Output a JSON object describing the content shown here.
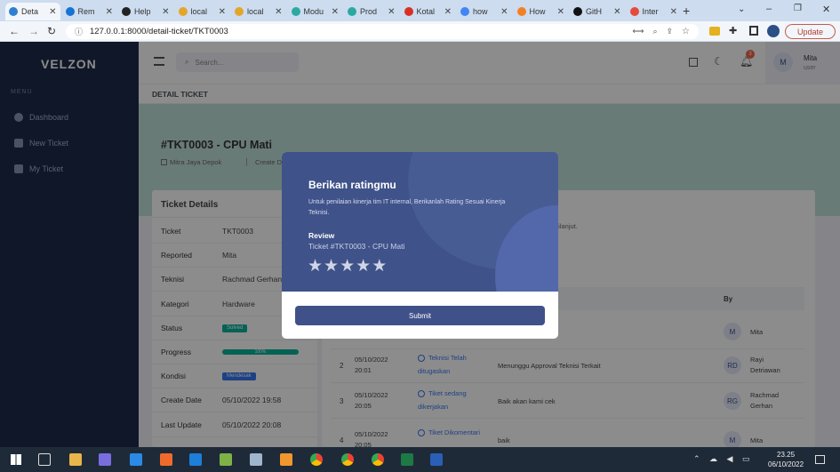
{
  "browser": {
    "tabs": [
      {
        "label": "Deta",
        "color": "#2f7fd1",
        "active": true
      },
      {
        "label": "Rem",
        "color": "#1573d4",
        "active": false
      },
      {
        "label": "Help",
        "color": "#222222",
        "active": false
      },
      {
        "label": "local",
        "color": "#e3a62a",
        "active": false
      },
      {
        "label": "local",
        "color": "#e3a62a",
        "active": false
      },
      {
        "label": "Modu",
        "color": "#2ba9a0",
        "active": false
      },
      {
        "label": "Prod",
        "color": "#2ba9a0",
        "active": false
      },
      {
        "label": "Kotal",
        "color": "#d93025",
        "active": false
      },
      {
        "label": "how",
        "color": "#4285f4",
        "active": false
      },
      {
        "label": "How",
        "color": "#f48024",
        "active": false
      },
      {
        "label": "GitH",
        "color": "#111111",
        "active": false
      },
      {
        "label": "Inter",
        "color": "#e64a3b",
        "active": false
      }
    ],
    "url": "127.0.0.1:8000/detail-ticket/TKT0003",
    "update_label": "Update"
  },
  "sidebar": {
    "logo": "VELZON",
    "menu_title": "MENU",
    "items": [
      {
        "label": "Dashboard"
      },
      {
        "label": "New Ticket"
      },
      {
        "label": "My Ticket"
      }
    ]
  },
  "header": {
    "search_placeholder": "Search...",
    "notification_count": "3",
    "avatar": "M",
    "user_name": "Mita",
    "user_role": "user"
  },
  "page": {
    "breadcrumb": "DETAIL TICKET",
    "ticket_title": "#TKT0003 - CPU Mati",
    "company": "Mitra Jaya Depok",
    "create_date_label": "Create Dat"
  },
  "details": {
    "title": "Ticket Details",
    "rows": [
      {
        "label": "Ticket",
        "value": "TKT0003"
      },
      {
        "label": "Reported",
        "value": "Mita"
      },
      {
        "label": "Teknisi",
        "value": "Rachmad Gerhan"
      },
      {
        "label": "Kategori",
        "value": "Hardware"
      },
      {
        "label": "Status",
        "value": "Solved"
      },
      {
        "label": "Progress",
        "value": "100%"
      },
      {
        "label": "Kondisi",
        "value": "Mendesak"
      },
      {
        "label": "Create Date",
        "value": "05/10/2022 19:58"
      },
      {
        "label": "Last Update",
        "value": "05/10/2022 20:08"
      }
    ],
    "progress": 100,
    "status_color": "#0ab39c",
    "kondisi_color": "#3577f1"
  },
  "history": {
    "partial_text": "dilanjut.",
    "col_by": "By",
    "rows": [
      {
        "no": "",
        "date": "",
        "time": "",
        "status": "",
        "status2": "",
        "note": "",
        "initials": "M",
        "by": "Mita",
        "by2": ""
      },
      {
        "no": "2",
        "date": "05/10/2022",
        "time": "20:01",
        "status": "Teknisi Telah",
        "status2": "ditugaskan",
        "note": "Menunggu Approval Teknisi Terkait",
        "initials": "RD",
        "by": "Rayi",
        "by2": "Detriawan"
      },
      {
        "no": "3",
        "date": "05/10/2022",
        "time": "20:05",
        "status": "Tiket sedang",
        "status2": "dikerjakan",
        "note": "Baik akan kami cek",
        "initials": "RG",
        "by": "Rachmad",
        "by2": "Gerhan"
      },
      {
        "no": "4",
        "date": "05/10/2022",
        "time": "20:05",
        "status": "Tiket Dikomentari",
        "status2": "",
        "note": "baik",
        "initials": "M",
        "by": "Mita",
        "by2": ""
      }
    ]
  },
  "modal": {
    "title": "Berikan ratingmu",
    "description": "Untuk penilaian kinerja tim IT internal, Berikanlah Rating Sesuai Kinerja Teknisi.",
    "review_label": "Review",
    "ticket_ref": "Ticket #TKT0003 - CPU Mati",
    "stars": [
      "★",
      "★",
      "★",
      "★",
      "★"
    ],
    "submit_label": "Submit"
  },
  "taskbar": {
    "time": "23.25",
    "date": "06/10/2022"
  }
}
